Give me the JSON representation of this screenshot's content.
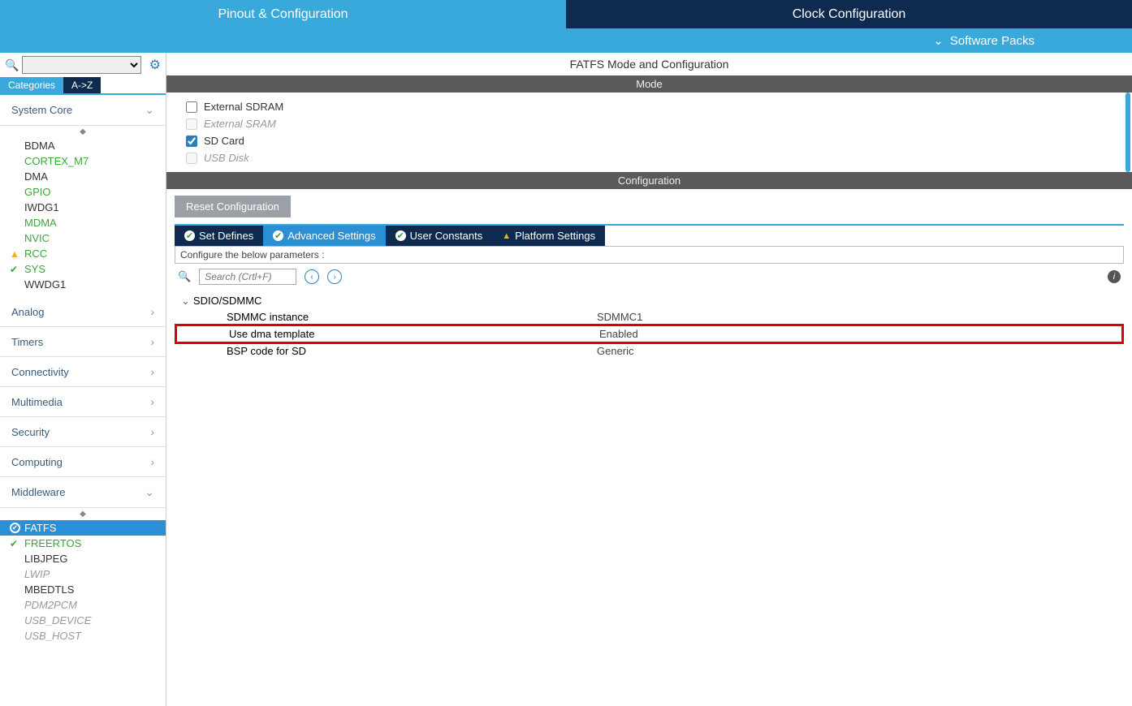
{
  "tabs": {
    "pinout": "Pinout & Configuration",
    "clock": "Clock Configuration"
  },
  "subbar": {
    "software_packs": "Software Packs"
  },
  "sidebar": {
    "view_tabs": {
      "categories": "Categories",
      "az": "A->Z"
    },
    "categories": [
      {
        "name": "System Core",
        "expanded": true,
        "items": [
          {
            "label": "BDMA",
            "style": "dark"
          },
          {
            "label": "CORTEX_M7",
            "style": "green"
          },
          {
            "label": "DMA",
            "style": "dark"
          },
          {
            "label": "GPIO",
            "style": "green"
          },
          {
            "label": "IWDG1",
            "style": "dark"
          },
          {
            "label": "MDMA",
            "style": "green"
          },
          {
            "label": "NVIC",
            "style": "green"
          },
          {
            "label": "RCC",
            "style": "green",
            "status": "warn"
          },
          {
            "label": "SYS",
            "style": "green",
            "status": "ok"
          },
          {
            "label": "WWDG1",
            "style": "dark"
          }
        ]
      },
      {
        "name": "Analog",
        "expanded": false
      },
      {
        "name": "Timers",
        "expanded": false
      },
      {
        "name": "Connectivity",
        "expanded": false
      },
      {
        "name": "Multimedia",
        "expanded": false
      },
      {
        "name": "Security",
        "expanded": false
      },
      {
        "name": "Computing",
        "expanded": false
      },
      {
        "name": "Middleware",
        "expanded": true,
        "items": [
          {
            "label": "FATFS",
            "style": "selected",
            "status": "okcircle"
          },
          {
            "label": "FREERTOS",
            "style": "green",
            "status": "ok"
          },
          {
            "label": "LIBJPEG",
            "style": "dark"
          },
          {
            "label": "LWIP",
            "style": "gray"
          },
          {
            "label": "MBEDTLS",
            "style": "dark"
          },
          {
            "label": "PDM2PCM",
            "style": "gray"
          },
          {
            "label": "USB_DEVICE",
            "style": "gray"
          },
          {
            "label": "USB_HOST",
            "style": "gray"
          }
        ]
      }
    ]
  },
  "content": {
    "title": "FATFS Mode and Configuration",
    "mode_header": "Mode",
    "modes": [
      {
        "label": "External SDRAM",
        "checked": false,
        "disabled": false
      },
      {
        "label": "External SRAM",
        "checked": false,
        "disabled": true
      },
      {
        "label": "SD Card",
        "checked": true,
        "disabled": false
      },
      {
        "label": "USB Disk",
        "checked": false,
        "disabled": true
      }
    ],
    "config_header": "Configuration",
    "reset_label": "Reset Configuration",
    "cfg_tabs": [
      {
        "label": "Set Defines",
        "icon": "ok",
        "active": false
      },
      {
        "label": "Advanced Settings",
        "icon": "ok",
        "active": true
      },
      {
        "label": "User Constants",
        "icon": "ok",
        "active": false
      },
      {
        "label": "Platform Settings",
        "icon": "warn",
        "active": false
      }
    ],
    "param_hint": "Configure the below parameters :",
    "search_placeholder": "Search (Crtl+F)",
    "tree": {
      "root": "SDIO/SDMMC",
      "rows": [
        {
          "label": "SDMMC instance",
          "value": "SDMMC1",
          "highlight": false
        },
        {
          "label": "Use dma template",
          "value": "Enabled",
          "highlight": true
        },
        {
          "label": "BSP code for SD",
          "value": "Generic",
          "highlight": false
        }
      ]
    }
  }
}
